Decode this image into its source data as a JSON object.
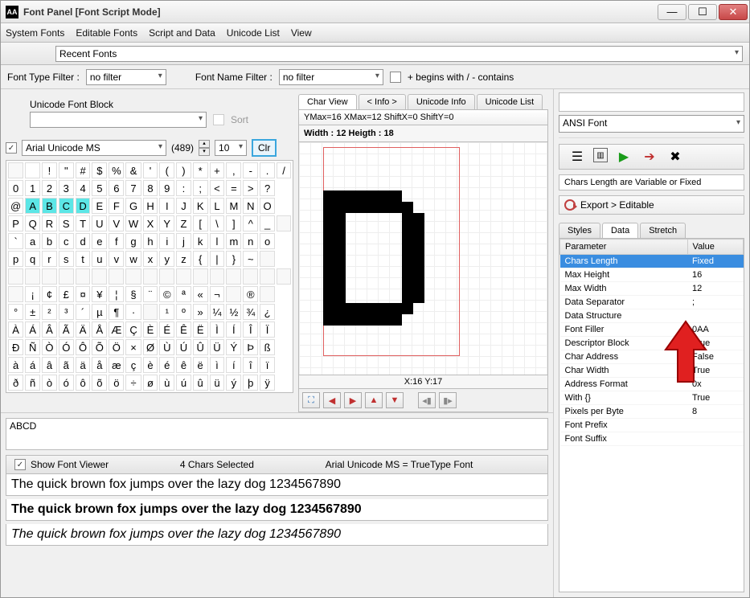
{
  "window": {
    "icon_text": "AA",
    "title": "Font Panel [Font Script Mode]"
  },
  "menu": {
    "system_fonts": "System Fonts",
    "editable_fonts": "Editable Fonts",
    "script_data": "Script and Data",
    "unicode_list": "Unicode List",
    "view": "View"
  },
  "recent": {
    "label": "Recent Fonts"
  },
  "filters": {
    "type_label": "Font Type Filter :",
    "type_value": "no filter",
    "name_label": "Font Name Filter :",
    "name_value": "no filter",
    "begins_label": "+ begins with / - contains"
  },
  "ufb": {
    "label": "Unicode Font Block",
    "sort": "Sort"
  },
  "fontsel": {
    "name": "Arial Unicode MS",
    "count": "(489)",
    "size": "10",
    "clr": "Clr"
  },
  "char_grid": {
    "rows": [
      [
        "",
        " ",
        "!",
        "\"",
        "#",
        "$",
        "%",
        "&",
        "'",
        "(",
        ")",
        "*",
        "+",
        ",",
        "-",
        ".",
        "/"
      ],
      [
        "0",
        "1",
        "2",
        "3",
        "4",
        "5",
        "6",
        "7",
        "8",
        "9",
        ":",
        ";",
        "<",
        "=",
        ">",
        "?"
      ],
      [
        "@",
        "A",
        "B",
        "C",
        "D",
        "E",
        "F",
        "G",
        "H",
        "I",
        "J",
        "K",
        "L",
        "M",
        "N",
        "O"
      ],
      [
        "P",
        "Q",
        "R",
        "S",
        "T",
        "U",
        "V",
        "W",
        "X",
        "Y",
        "Z",
        "[",
        "\\",
        "]",
        "^",
        "_",
        ""
      ],
      [
        "`",
        "a",
        "b",
        "c",
        "d",
        "e",
        "f",
        "g",
        "h",
        "i",
        "j",
        "k",
        "l",
        "m",
        "n",
        "o"
      ],
      [
        "p",
        "q",
        "r",
        "s",
        "t",
        "u",
        "v",
        "w",
        "x",
        "y",
        "z",
        "{",
        "|",
        "}",
        "~",
        ""
      ],
      [
        "",
        "",
        "",
        "",
        "",
        "",
        "",
        "",
        "",
        "",
        "",
        "",
        "",
        "",
        "",
        "",
        ""
      ],
      [
        "",
        "¡",
        "¢",
        "£",
        "¤",
        "¥",
        "¦",
        "§",
        "¨",
        "©",
        "ª",
        "«",
        "¬",
        "",
        "®",
        ""
      ],
      [
        "°",
        "±",
        "²",
        "³",
        "´",
        "µ",
        "¶",
        "·",
        "",
        "¹",
        "º",
        "»",
        "¼",
        "½",
        "¾",
        "¿"
      ],
      [
        "À",
        "Á",
        "Â",
        "Ã",
        "Ä",
        "Å",
        "Æ",
        "Ç",
        "È",
        "É",
        "Ê",
        "Ë",
        "Ì",
        "Í",
        "Î",
        "Ï"
      ],
      [
        "Ð",
        "Ñ",
        "Ò",
        "Ó",
        "Ô",
        "Õ",
        "Ö",
        "×",
        "Ø",
        "Ù",
        "Ú",
        "Û",
        "Ü",
        "Ý",
        "Þ",
        "ß"
      ],
      [
        "à",
        "á",
        "â",
        "ã",
        "ä",
        "å",
        "æ",
        "ç",
        "è",
        "é",
        "ê",
        "ë",
        "ì",
        "í",
        "î",
        "ï"
      ],
      [
        "ð",
        "ñ",
        "ò",
        "ó",
        "ô",
        "õ",
        "ö",
        "÷",
        "ø",
        "ù",
        "ú",
        "û",
        "ü",
        "ý",
        "þ",
        "ÿ"
      ]
    ],
    "selected": [
      "A",
      "B",
      "C",
      "D"
    ]
  },
  "charview": {
    "tabs": {
      "char_view": "Char View",
      "info": "< Info >",
      "unicode_info": "Unicode Info",
      "unicode_list": "Unicode List"
    },
    "metrics": "YMax=16  XMax=12  ShiftX=0  ShiftY=0",
    "wh": "Width : 12  Heigth : 18",
    "coords": "X:16 Y:17"
  },
  "selected_text": "ABCD",
  "viewer": {
    "show": "Show Font Viewer",
    "chars_selected": "4 Chars Selected",
    "fontinfo": "Arial Unicode MS = TrueType Font",
    "sample": "The quick brown fox jumps over the lazy dog 1234567890"
  },
  "right": {
    "ansi": "ANSI Font",
    "status": "Chars Length are Variable or Fixed",
    "export": "Export > Editable",
    "tabs": {
      "styles": "Styles",
      "data": "Data",
      "stretch": "Stretch"
    },
    "headers": {
      "param": "Parameter",
      "value": "Value"
    },
    "params": [
      {
        "p": "Chars Length",
        "v": "Fixed",
        "sel": true
      },
      {
        "p": "Max Height",
        "v": "16"
      },
      {
        "p": "Max Width",
        "v": "12"
      },
      {
        "p": "Data Separator",
        "v": ";"
      },
      {
        "p": "Data Structure",
        "v": ""
      },
      {
        "p": "Font Filler",
        "v": "0AA"
      },
      {
        "p": "Descriptor Block",
        "v": "True"
      },
      {
        "p": "Char Address",
        "v": "False"
      },
      {
        "p": "Char Width",
        "v": "True"
      },
      {
        "p": "Address Format",
        "v": "0x"
      },
      {
        "p": "With {}",
        "v": "True"
      },
      {
        "p": "Pixels per Byte",
        "v": "8"
      },
      {
        "p": "Font Prefix",
        "v": ""
      },
      {
        "p": "Font Suffix",
        "v": ""
      }
    ]
  },
  "glyph_D": [
    "1111111000",
    "1111111100",
    "1100000110",
    "1100000110",
    "1100000110",
    "1100000110",
    "1100000110",
    "1100000110",
    "1100000110",
    "1100000110",
    "1111111100",
    "1111111000"
  ]
}
